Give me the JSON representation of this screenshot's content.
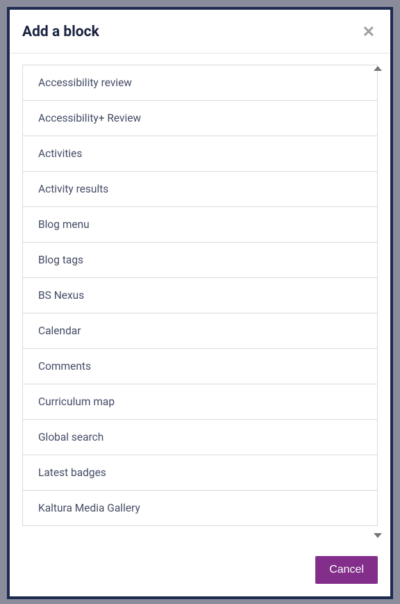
{
  "modal": {
    "title": "Add a block",
    "cancel_label": "Cancel"
  },
  "blocks": [
    {
      "label": "Accessibility review"
    },
    {
      "label": "Accessibility+ Review"
    },
    {
      "label": "Activities"
    },
    {
      "label": "Activity results"
    },
    {
      "label": "Blog menu"
    },
    {
      "label": "Blog tags"
    },
    {
      "label": "BS Nexus"
    },
    {
      "label": "Calendar"
    },
    {
      "label": "Comments"
    },
    {
      "label": "Curriculum map"
    },
    {
      "label": "Global search"
    },
    {
      "label": "Latest badges"
    },
    {
      "label": "Kaltura Media Gallery"
    }
  ],
  "colors": {
    "accent": "#822e8a",
    "border_dark": "#1e2b50"
  }
}
